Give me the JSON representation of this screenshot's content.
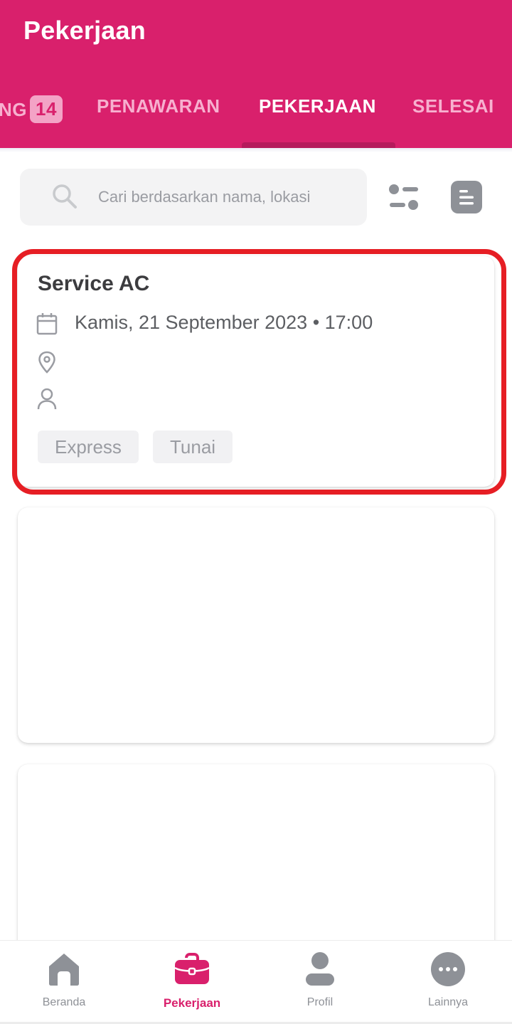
{
  "app": {
    "title": "Pekerjaan"
  },
  "tabs": [
    {
      "label": "NG",
      "badge": "14"
    },
    {
      "label": "PENAWARAN"
    },
    {
      "label": "PEKERJAAN",
      "active": true
    },
    {
      "label": "SELESAI"
    }
  ],
  "search": {
    "placeholder": "Cari berdasarkan nama, lokasi",
    "value": ""
  },
  "toolbar": {
    "filter_icon": "filter-icon",
    "list_icon": "list-view-icon"
  },
  "jobs": [
    {
      "title": "Service AC",
      "datetime": "Kamis, 21 September 2023 • 17:00",
      "location": "",
      "customer": "",
      "tags": [
        "Express",
        "Tunai"
      ]
    }
  ],
  "bottom_nav": [
    {
      "label": "Beranda",
      "icon": "home-icon"
    },
    {
      "label": "Pekerjaan",
      "icon": "briefcase-icon",
      "active": true
    },
    {
      "label": "Profil",
      "icon": "profile-icon"
    },
    {
      "label": "Lainnya",
      "icon": "more-icon"
    }
  ],
  "colors": {
    "brand": "#d9206c",
    "highlight": "#e61e24",
    "inactive": "#8e9197"
  }
}
